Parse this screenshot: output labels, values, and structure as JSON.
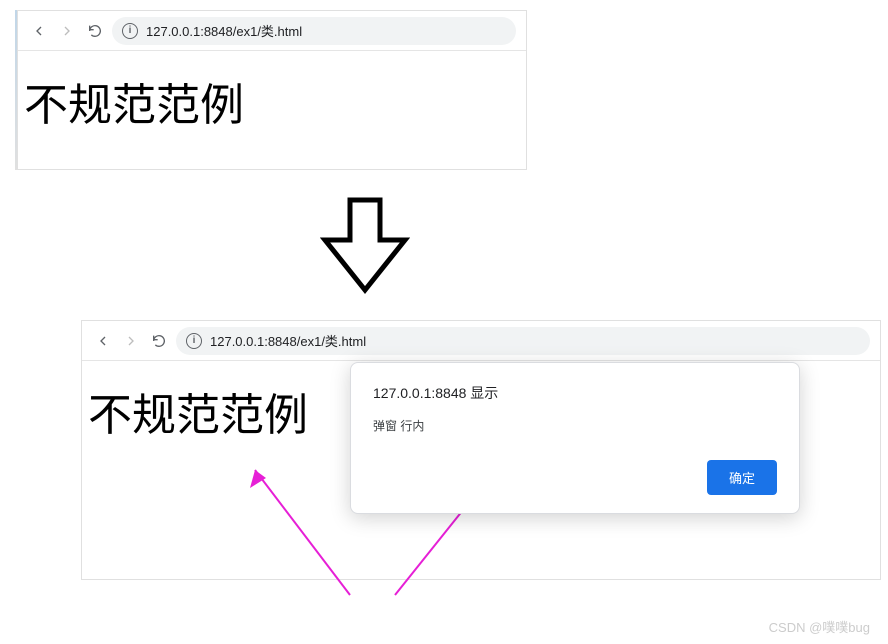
{
  "browser1": {
    "url": "127.0.0.1:8848/ex1/类.html",
    "heading": "不规范范例"
  },
  "browser2": {
    "url": "127.0.0.1:8848/ex1/类.html",
    "heading": "不规范范例"
  },
  "alert": {
    "title": "127.0.0.1:8848 显示",
    "message": "弹窗 行内",
    "ok_label": "确定"
  },
  "watermark": "CSDN @噗噗bug",
  "info_glyph": "i"
}
